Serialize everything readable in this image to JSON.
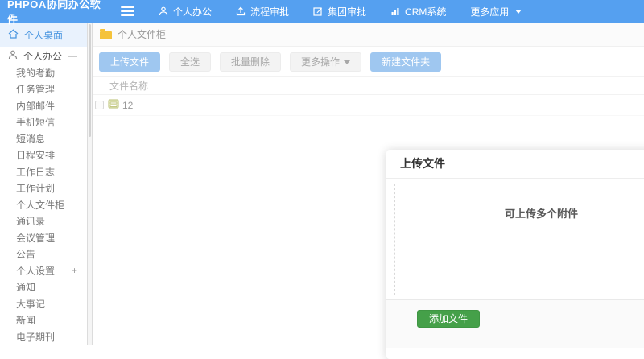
{
  "app": {
    "title": "PHPOA协同办公软件"
  },
  "topnav": {
    "items": [
      {
        "label": "个人办公",
        "icon": "user-icon"
      },
      {
        "label": "流程审批",
        "icon": "process-icon"
      },
      {
        "label": "集团审批",
        "icon": "edit-icon"
      },
      {
        "label": "CRM系统",
        "icon": "chart-icon"
      },
      {
        "label": "更多应用",
        "icon": "caret-down-icon"
      }
    ]
  },
  "sidebar": {
    "desktop_label": "个人桌面",
    "group_label": "个人办公",
    "group_toggle": "—",
    "settings_toggle": "+",
    "items": [
      "我的考勤",
      "任务管理",
      "内部邮件",
      "手机短信",
      "短消息",
      "日程安排",
      "工作日志",
      "工作计划",
      "个人文件柜",
      "通讯录",
      "会议管理",
      "公告",
      "个人设置",
      "通知",
      "大事记",
      "新闻",
      "电子期刊"
    ]
  },
  "breadcrumb": {
    "label": "个人文件柜"
  },
  "toolbar": {
    "upload": "上传文件",
    "select_all": "全选",
    "batch_delete": "批量删除",
    "more_ops": "更多操作",
    "new_folder": "新建文件夹"
  },
  "table": {
    "header": "文件名称",
    "rows": [
      {
        "name": "12"
      }
    ]
  },
  "modal": {
    "title": "上传文件",
    "dropzone_hint": "可上传多个附件",
    "add_file": "添加文件"
  },
  "colors": {
    "topbar_blue": "#55a0f0",
    "active_item_bg": "#e9f2fd",
    "active_item_text": "#4a96e0",
    "primary_button_bg": "#9fc7f0",
    "green_button_bg": "#45a049",
    "folder_yellow": "#f5c33b"
  }
}
